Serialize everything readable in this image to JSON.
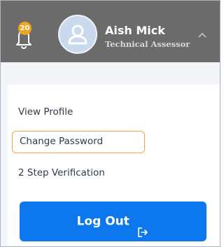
{
  "header": {
    "notifications": {
      "icon": "bell-icon",
      "count": "20",
      "badge_color": "#f1a51c"
    },
    "user": {
      "avatar_icon": "user-avatar-icon",
      "name": "Aish Mick",
      "role": "Technical Assessor"
    },
    "toggle_icon": "chevron-up-icon",
    "background_color": "#6b6b6b"
  },
  "menu": {
    "items": [
      {
        "label": "View Profile"
      },
      {
        "label": "Change Password",
        "highlighted": true
      },
      {
        "label": "2 Step Verification"
      }
    ],
    "highlight_color": "#f4a347"
  },
  "logout": {
    "label": "Log Out",
    "icon": "log-out-icon",
    "color": "#0d77ee"
  }
}
